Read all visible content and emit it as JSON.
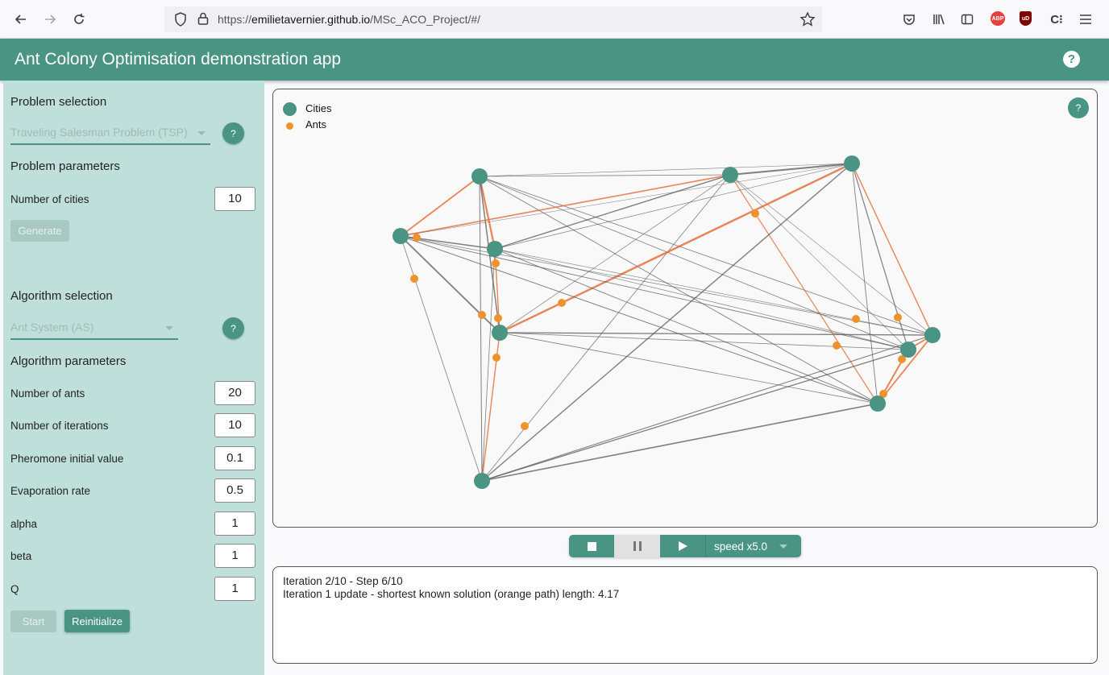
{
  "browser": {
    "url_prefix": "https://",
    "url_domain": "emilietavernier.github.io",
    "url_path": "/MSc_ACO_Project/#/",
    "abp_label": "ABP",
    "ubo_label": "uD"
  },
  "header": {
    "title": "Ant Colony Optimisation demonstration app",
    "help_label": "?"
  },
  "sidebar": {
    "problem_selection_title": "Problem selection",
    "problem_select_value": "Traveling Salesman Problem (TSP)",
    "problem_help": "?",
    "problem_parameters_title": "Problem parameters",
    "number_of_cities_label": "Number of cities",
    "number_of_cities_value": "10",
    "generate_label": "Generate",
    "algorithm_selection_title": "Algorithm selection",
    "algorithm_select_value": "Ant System (AS)",
    "algorithm_help": "?",
    "algorithm_parameters_title": "Algorithm parameters",
    "params": [
      {
        "label": "Number of ants",
        "value": "20"
      },
      {
        "label": "Number of iterations",
        "value": "10"
      },
      {
        "label": "Pheromone initial value",
        "value": "0.1"
      },
      {
        "label": "Evaporation rate",
        "value": "0.5"
      },
      {
        "label": "alpha",
        "value": "1"
      },
      {
        "label": "beta",
        "value": "1"
      },
      {
        "label": "Q",
        "value": "1"
      }
    ],
    "start_label": "Start",
    "reinitialize_label": "Reinitialize"
  },
  "graph": {
    "legend_cities": "Cities",
    "legend_ants": "Ants",
    "help_label": "?",
    "colors": {
      "city": "#4a9484",
      "ant": "#f0922b",
      "best_path": "#e8703a",
      "edge": "#555555"
    }
  },
  "controls": {
    "speed_label": "speed x5.0"
  },
  "log": {
    "line1": "Iteration 2/10 - Step 6/10",
    "line2": "Iteration 1 update - shortest known solution (orange path) length: 4.17"
  }
}
